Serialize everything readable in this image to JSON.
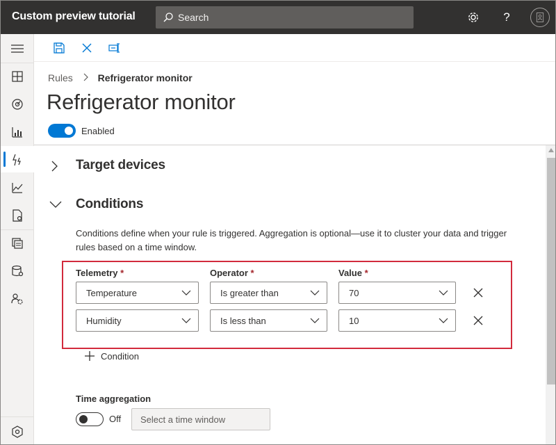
{
  "app": {
    "title": "Custom preview tutorial"
  },
  "search": {
    "placeholder": "Search"
  },
  "breadcrumb": {
    "root": "Rules",
    "current": "Refrigerator monitor"
  },
  "page": {
    "title": "Refrigerator monitor",
    "enabled_label": "Enabled",
    "enabled": true
  },
  "sections": {
    "target_devices": {
      "label": "Target devices",
      "expanded": false
    },
    "conditions": {
      "label": "Conditions",
      "expanded": true,
      "description": "Conditions define when your rule is triggered. Aggregation is optional—use it to cluster your data and trigger rules based on a time window."
    }
  },
  "conditions_table": {
    "headers": {
      "telemetry": "Telemetry",
      "operator": "Operator",
      "value": "Value",
      "required_mark": "*"
    },
    "rows": [
      {
        "telemetry": "Temperature",
        "operator": "Is greater than",
        "value": "70"
      },
      {
        "telemetry": "Humidity",
        "operator": "Is less than",
        "value": "10"
      }
    ],
    "add_label": "Condition"
  },
  "time_aggregation": {
    "label": "Time aggregation",
    "toggle_label": "Off",
    "enabled": false,
    "window_placeholder": "Select a time window"
  },
  "colors": {
    "topbar": "#323130",
    "accent": "#0078d4",
    "highlight": "#d22a3c",
    "required": "#a4262c"
  },
  "icons": {
    "nav": [
      "hamburger-icon",
      "dashboard-icon",
      "devices-icon",
      "analytics-icon",
      "rules-icon",
      "chart-icon",
      "jobs-icon",
      "device-templates-icon",
      "data-export-icon",
      "admin-icon",
      "settings-icon"
    ],
    "commands": [
      "save-icon",
      "cancel-icon",
      "rename-icon"
    ]
  }
}
